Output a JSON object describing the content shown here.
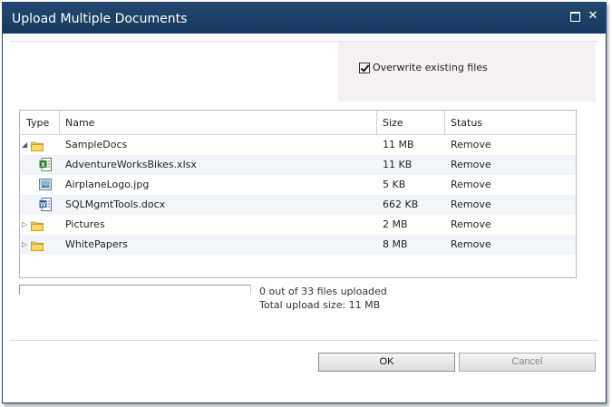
{
  "dialog": {
    "title": "Upload Multiple Documents",
    "maximize_icon": "maximize-icon",
    "close_icon": "close-icon",
    "close_glyph": "✕"
  },
  "options": {
    "overwrite_checked": true,
    "overwrite_label": "Overwrite existing files"
  },
  "grid": {
    "columns": {
      "type": "Type",
      "name": "Name",
      "size": "Size",
      "status": "Status"
    },
    "rows": [
      {
        "icon": "folder-icon",
        "expander": "expanded",
        "name": "SampleDocs",
        "size": "11 MB",
        "status": "Remove"
      },
      {
        "icon": "excel-file-icon",
        "expander": "",
        "name": "AdventureWorksBikes.xlsx",
        "size": "11 KB",
        "status": "Remove"
      },
      {
        "icon": "image-file-icon",
        "expander": "",
        "name": "AirplaneLogo.jpg",
        "size": "5 KB",
        "status": "Remove"
      },
      {
        "icon": "word-file-icon",
        "expander": "",
        "name": "SQLMgmtTools.docx",
        "size": "662 KB",
        "status": "Remove"
      },
      {
        "icon": "folder-icon",
        "expander": "collapsed",
        "name": "Pictures",
        "size": "2 MB",
        "status": "Remove"
      },
      {
        "icon": "folder-icon",
        "expander": "collapsed",
        "name": "WhitePapers",
        "size": "8 MB",
        "status": "Remove"
      }
    ]
  },
  "progress": {
    "value": 0,
    "files_uploaded_text": "0 out of 33 files uploaded",
    "total_size_text": "Total upload size: 11 MB"
  },
  "buttons": {
    "ok_label": "OK",
    "cancel_label": "Cancel"
  },
  "colors": {
    "titlebar": "#1a3f64",
    "options_panel": "#f5f0f4",
    "alt_row": "#f2f6fb"
  }
}
